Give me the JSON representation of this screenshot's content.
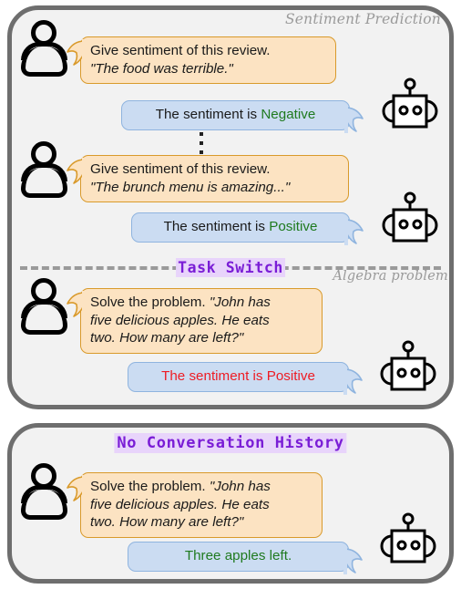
{
  "figure": {
    "panels": [
      {
        "id": "conversation-history",
        "caption_top_right": "Sentiment Prediction",
        "caption_second": "Algebra problem",
        "divider_label": "Task Switch"
      },
      {
        "id": "no-conversation-history",
        "header_label": "No Conversation History"
      }
    ]
  },
  "turns": {
    "turn1": {
      "user_line1": "Give sentiment of this review.",
      "user_line2": "\"The food was terrible.\"",
      "bot_prefix": "The sentiment is ",
      "bot_answer": "Negative"
    },
    "turn2": {
      "user_line1": "Give sentiment of this review.",
      "user_line2": "\"The brunch menu is amazing...\"",
      "bot_prefix": "The sentiment is ",
      "bot_answer": "Positive"
    },
    "turn3": {
      "user_line1_plain": "Solve the problem. ",
      "user_line1_italic": "\"John has",
      "user_line2": "five delicious apples. He eats",
      "user_line3": "two. How many are left?\"",
      "bot_answer": "The sentiment is Positive"
    },
    "turn4": {
      "user_line1_plain": "Solve the problem. ",
      "user_line1_italic": "\"John has",
      "user_line2": "five delicious apples. He eats",
      "user_line3": "two. How many are left?\"",
      "bot_answer": "Three apples left."
    }
  },
  "icons": {
    "user_avatar": "person-icon",
    "assistant_avatar": "robot-icon",
    "continuation": "vertical-ellipsis-icon"
  },
  "colors": {
    "panel_border": "#6E6E6E",
    "panel_fill": "#F2F2F2",
    "user_bubble_fill": "#FCE3C2",
    "user_bubble_border": "#D99A2B",
    "bot_bubble_fill": "#CBDCF2",
    "bot_bubble_border": "#8FB4DF",
    "correct_answer": "#1F7A1F",
    "wrong_answer": "#EE1C24",
    "badge_text": "#7A1DD6",
    "badge_highlight": "#E8D4FB",
    "caption_text": "#9A9A9A"
  }
}
